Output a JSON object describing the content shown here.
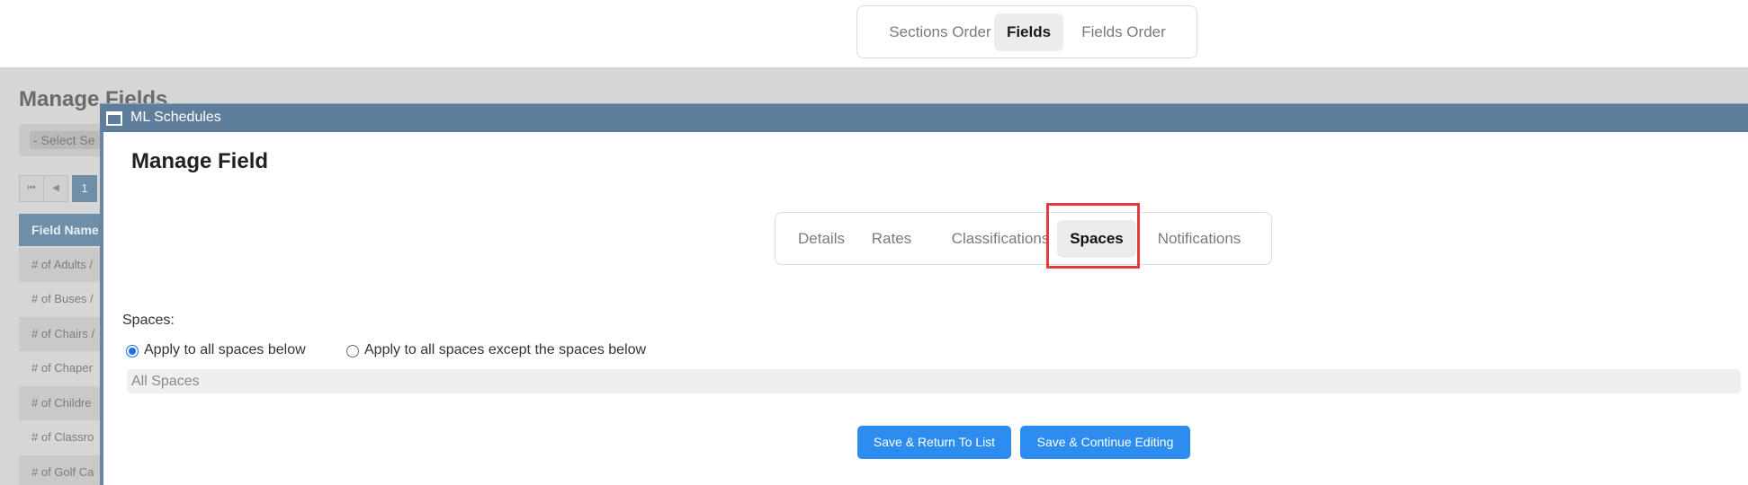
{
  "top_tabs": [
    {
      "label": "Sections Order",
      "active": false
    },
    {
      "label": "Fields",
      "active": true
    },
    {
      "label": "Fields Order",
      "active": false
    }
  ],
  "background_page": {
    "title": "Manage Fields",
    "select_placeholder": "- Select Se",
    "pager": {
      "first": "⏮",
      "prev": "◀",
      "page": "1"
    },
    "table_header": "Field Name",
    "rows": [
      "# of Adults /",
      "# of Buses /",
      "# of Chairs /",
      "# of Chaper",
      "# of Childre",
      "# of Classro",
      "# of Golf Ca"
    ]
  },
  "modal": {
    "title": "ML Schedules",
    "heading": "Manage Field",
    "tabs": [
      {
        "label": "Details",
        "active": false
      },
      {
        "label": "Rates",
        "active": false
      },
      {
        "label": "Classifications",
        "active": false
      },
      {
        "label": "Spaces",
        "active": true
      },
      {
        "label": "Notifications",
        "active": false
      }
    ],
    "spaces_label": "Spaces:",
    "radio_options": [
      {
        "label": "Apply to all spaces below",
        "checked": true
      },
      {
        "label": "Apply to all spaces except the spaces below",
        "checked": false
      }
    ],
    "all_spaces_text": "All Spaces",
    "buttons": {
      "save_return": "Save & Return To List",
      "save_continue": "Save & Continue Editing"
    }
  },
  "colors": {
    "accent_button": "#2d8cf0",
    "titlebar": "#5f7e9c",
    "highlight": "#e23b3b"
  }
}
